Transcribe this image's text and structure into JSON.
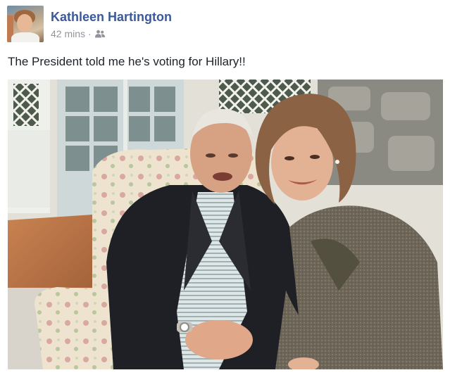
{
  "post": {
    "author": "Kathleen Hartington",
    "time": "42 mins",
    "separator": "·",
    "audience_icon": "friends-icon",
    "text": "The President told me he's voting for Hillary!!"
  },
  "colors": {
    "author_link": "#3b5998",
    "meta": "#90949c",
    "text": "#1d2129"
  }
}
